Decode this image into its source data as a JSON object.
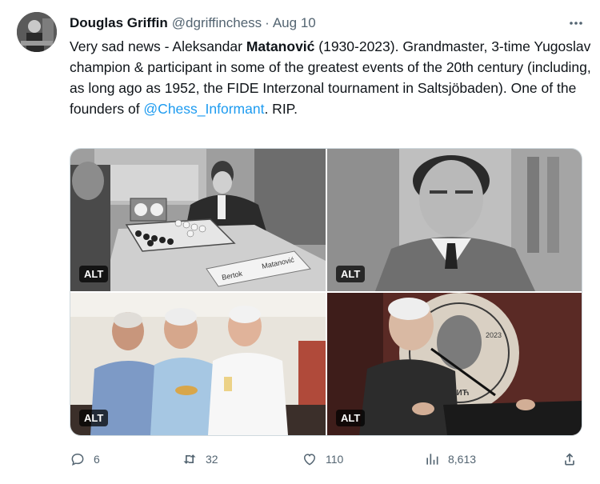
{
  "author": {
    "name": "Douglas Griffin",
    "handle": "@dgriffinchess",
    "separator": "·",
    "date": "Aug 10"
  },
  "more_label": "•••",
  "tweet": {
    "part1": "Very sad news - Aleksandar ",
    "bold": "Matanović",
    "part2": " (1930-2023). Grandmaster, 3-time Yugoslav champion & participant in some of the greatest events of the 20th century (including, as long ago as 1952, the FIDE Interzonal tournament in Saltsjöbaden). One of the founders of ",
    "mention": "@Chess_Informant",
    "part3": ". RIP."
  },
  "media": {
    "photos": [
      {
        "alt_badge": "ALT",
        "caption_a": "Bertok",
        "caption_b": "Matanović"
      },
      {
        "alt_badge": "ALT"
      },
      {
        "alt_badge": "ALT"
      },
      {
        "alt_badge": "ALT",
        "poster_text": "ГАНГОРИЋ",
        "poster_year": "2023"
      }
    ]
  },
  "actions": {
    "replies": "6",
    "retweets": "32",
    "likes": "110",
    "views": "8,613"
  }
}
